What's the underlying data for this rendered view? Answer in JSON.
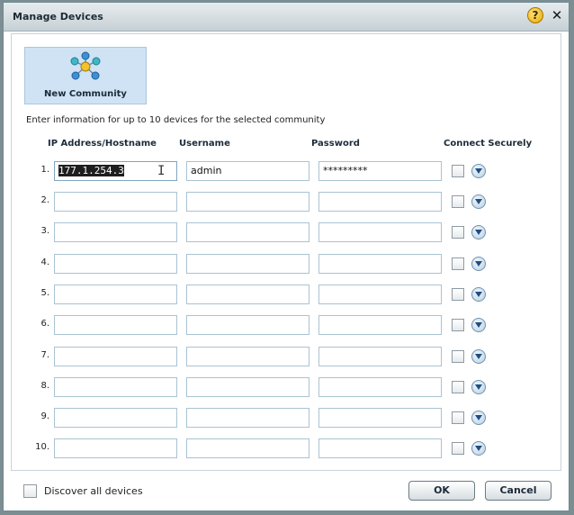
{
  "dialog": {
    "title": "Manage Devices",
    "help_glyph": "?",
    "close_glyph": "✕"
  },
  "community": {
    "label": "New Community"
  },
  "instruction": "Enter information for up to 10 devices for the selected community",
  "columns": {
    "ip": "IP Address/Hostname",
    "username": "Username",
    "password": "Password",
    "connect": "Connect Securely"
  },
  "rows": [
    {
      "num": "1.",
      "ip": "177.1.254.3",
      "username": "admin",
      "password": "*********",
      "secure": false
    },
    {
      "num": "2.",
      "ip": "",
      "username": "",
      "password": "",
      "secure": false
    },
    {
      "num": "3.",
      "ip": "",
      "username": "",
      "password": "",
      "secure": false
    },
    {
      "num": "4.",
      "ip": "",
      "username": "",
      "password": "",
      "secure": false
    },
    {
      "num": "5.",
      "ip": "",
      "username": "",
      "password": "",
      "secure": false
    },
    {
      "num": "6.",
      "ip": "",
      "username": "",
      "password": "",
      "secure": false
    },
    {
      "num": "7.",
      "ip": "",
      "username": "",
      "password": "",
      "secure": false
    },
    {
      "num": "8.",
      "ip": "",
      "username": "",
      "password": "",
      "secure": false
    },
    {
      "num": "9.",
      "ip": "",
      "username": "",
      "password": "",
      "secure": false
    },
    {
      "num": "10.",
      "ip": "",
      "username": "",
      "password": "",
      "secure": false
    }
  ],
  "footer": {
    "discover_label": "Discover all devices",
    "ok_label": "OK",
    "cancel_label": "Cancel"
  },
  "icons": {
    "community": "community-network-icon",
    "help": "help-icon",
    "close": "close-icon",
    "dropdown": "dropdown-chevron-icon"
  }
}
